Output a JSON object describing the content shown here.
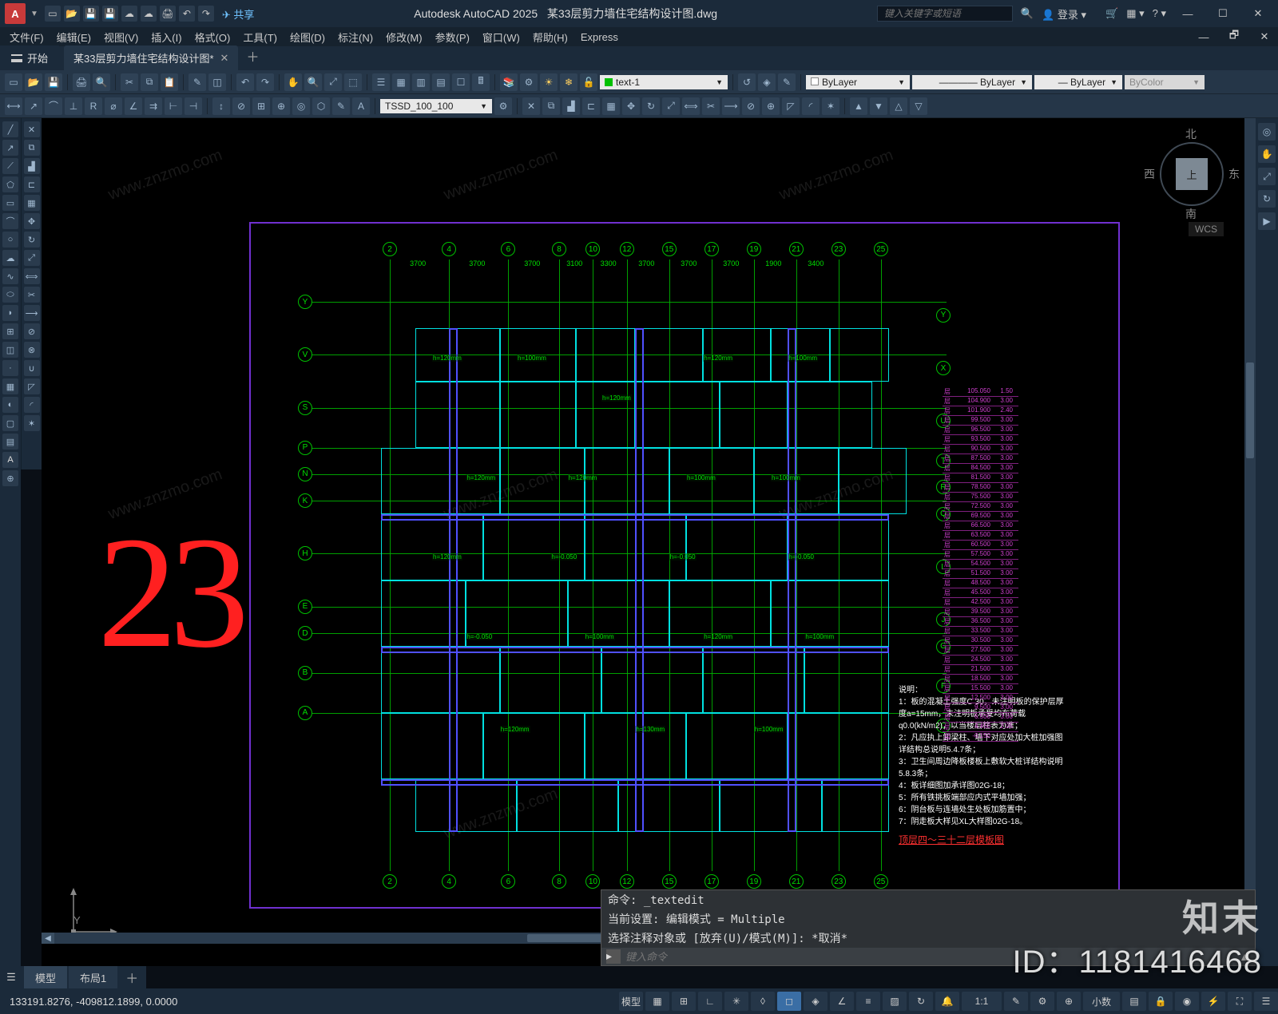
{
  "title": {
    "app": "Autodesk AutoCAD 2025",
    "doc": "某33层剪力墙住宅结构设计图.dwg"
  },
  "search_placeholder": "键入关键字或短语",
  "login_label": "登录",
  "share_label": "共享",
  "menubar": [
    "文件(F)",
    "编辑(E)",
    "视图(V)",
    "插入(I)",
    "格式(O)",
    "工具(T)",
    "绘图(D)",
    "标注(N)",
    "修改(M)",
    "参数(P)",
    "窗口(W)",
    "帮助(H)",
    "Express"
  ],
  "start_label": "开始",
  "filetab": {
    "name": "某33层剪力墙住宅结构设计图*"
  },
  "layer_current": "text-1",
  "props": {
    "bylayer1": "ByLayer",
    "bylayer2": "ByLayer",
    "bylayer3": "ByLayer",
    "bycolor": "ByColor"
  },
  "tssd_input": "TSSD_100_100",
  "viewcube": {
    "face": "上",
    "n": "北",
    "s": "南",
    "e": "东",
    "w": "西",
    "wcs": "WCS"
  },
  "big_number": "23",
  "gridmarks_top": [
    "2",
    "4",
    "6",
    "8",
    "10",
    "12",
    "15",
    "17",
    "19",
    "21",
    "23",
    "25"
  ],
  "gridmarks_side": [
    "Y",
    "V",
    "S",
    "P",
    "N",
    "K",
    "H",
    "E",
    "D",
    "B",
    "A"
  ],
  "gridmarks_side_r": [
    "Y",
    "X",
    "U",
    "T",
    "R",
    "Q",
    "L",
    "J",
    "G",
    "F",
    "C"
  ],
  "dims_top": [
    "3700",
    "3700",
    "3700",
    "3100",
    "3300",
    "3700",
    "3700",
    "3700",
    "1900",
    "3400"
  ],
  "drawing_title": "顶层四～三十二层模板图",
  "notes": {
    "head": "说明：",
    "items": [
      "1：板的混凝土强度C 30，未注明板的保护层厚度a=15mm，未注明板承受均布荷载q0.0(kN/m2)，以当楼层柱表为准；",
      "2：凡应执上卸梁柱、墙下对应处加大桩加强图详结构总说明5.4.7条；",
      "3：卫生间周边降板楼板上敷软大桩详结构说明5.8.3条；",
      "4：板详细图加承详图02G-18；",
      "5：所有铁挑板端部应内式平墙加强；",
      "6：阴台板与连墙处生处板加筋置中；",
      "7：阴走板大样见XL大样图02G-18。"
    ]
  },
  "schedule_rows": [
    [
      "层",
      "105.050",
      "1.50"
    ],
    [
      "层",
      "104.900",
      "3.00"
    ],
    [
      "层",
      "101.900",
      "2.40"
    ],
    [
      "层",
      "99.500",
      "3.00"
    ],
    [
      "层",
      "96.500",
      "3.00"
    ],
    [
      "层",
      "93.500",
      "3.00"
    ],
    [
      "层",
      "90.500",
      "3.00"
    ],
    [
      "层",
      "87.500",
      "3.00"
    ],
    [
      "层",
      "84.500",
      "3.00"
    ],
    [
      "层",
      "81.500",
      "3.00"
    ],
    [
      "层",
      "78.500",
      "3.00"
    ],
    [
      "层",
      "75.500",
      "3.00"
    ],
    [
      "层",
      "72.500",
      "3.00"
    ],
    [
      "层",
      "69.500",
      "3.00"
    ],
    [
      "层",
      "66.500",
      "3.00"
    ],
    [
      "层",
      "63.500",
      "3.00"
    ],
    [
      "层",
      "60.500",
      "3.00"
    ],
    [
      "层",
      "57.500",
      "3.00"
    ],
    [
      "层",
      "54.500",
      "3.00"
    ],
    [
      "层",
      "51.500",
      "3.00"
    ],
    [
      "层",
      "48.500",
      "3.00"
    ],
    [
      "层",
      "45.500",
      "3.00"
    ],
    [
      "层",
      "42.500",
      "3.00"
    ],
    [
      "层",
      "39.500",
      "3.00"
    ],
    [
      "层",
      "36.500",
      "3.00"
    ],
    [
      "层",
      "33.500",
      "3.00"
    ],
    [
      "层",
      "30.500",
      "3.00"
    ],
    [
      "层",
      "27.500",
      "3.00"
    ],
    [
      "层",
      "24.500",
      "3.00"
    ],
    [
      "层",
      "21.500",
      "3.00"
    ],
    [
      "层",
      "18.500",
      "3.00"
    ],
    [
      "层",
      "15.500",
      "3.00"
    ],
    [
      "层",
      "12.500",
      "3.00"
    ],
    [
      "层",
      "9.500",
      "3.00"
    ],
    [
      "层",
      "6.500",
      "3.00"
    ],
    [
      "层",
      "4.450",
      "2.05"
    ],
    [
      "层",
      "-0.150",
      ""
    ]
  ],
  "slab_labels": [
    "h=120mm",
    "h=100mm",
    "h=120mm",
    "h=120mm",
    "h=100mm",
    "h=120mm",
    "h=120mm",
    "h=100mm",
    "h=100mm",
    "h=120mm",
    "h=-0.050",
    "h=-0.050",
    "h=-0.050",
    "h=-0.050",
    "h=100mm",
    "h=120mm",
    "h=100mm",
    "h=120mm",
    "h=130mm",
    "h=100mm"
  ],
  "cmd": {
    "line1": "命令: _textedit",
    "line2": "当前设置: 编辑模式 = Multiple",
    "line3": "选择注释对象或 [放弃(U)/模式(M)]: *取消*",
    "placeholder": "键入命令"
  },
  "layout_tabs": {
    "model": "模型",
    "layout1": "布局1"
  },
  "status": {
    "coords": "133191.8276, -409812.1899, 0.0000",
    "model_btn": "模型",
    "scale": "1:1",
    "decimal": "小数"
  },
  "ucs": {
    "x": "X",
    "y": "Y"
  },
  "watermark": {
    "id": "ID：1181416468",
    "logo": "知末",
    "url": "www.znzmo.com"
  }
}
